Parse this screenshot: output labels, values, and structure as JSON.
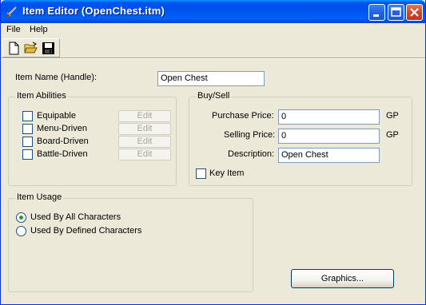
{
  "window": {
    "title": "Item Editor  (OpenChest.itm)",
    "icon": "sword-icon"
  },
  "menu": [
    "File",
    "Help"
  ],
  "toolbar": {
    "tools": [
      "new-file-icon",
      "open-folder-icon",
      "save-disk-icon"
    ]
  },
  "item_name": {
    "label": "Item Name (Handle):",
    "value": "Open Chest"
  },
  "abilities": {
    "title": "Item Abilities",
    "items": [
      {
        "label": "Equipable",
        "checked": false,
        "edit_label": "Edit"
      },
      {
        "label": "Menu-Driven",
        "checked": false,
        "edit_label": "Edit"
      },
      {
        "label": "Board-Driven",
        "checked": false,
        "edit_label": "Edit"
      },
      {
        "label": "Battle-Driven",
        "checked": false,
        "edit_label": "Edit"
      }
    ]
  },
  "buysell": {
    "title": "Buy/Sell",
    "purchase_label": "Purchase Price:",
    "purchase_value": "0",
    "purchase_unit": "GP",
    "selling_label": "Selling Price:",
    "selling_value": "0",
    "selling_unit": "GP",
    "description_label": "Description:",
    "description_value": "Open Chest",
    "key_item_label": "Key Item",
    "key_item_checked": false
  },
  "usage": {
    "title": "Item Usage",
    "options": [
      {
        "label": "Used By All Characters",
        "selected": true
      },
      {
        "label": "Used By Defined Characters",
        "selected": false
      }
    ]
  },
  "graphics_button": "Graphics..."
}
